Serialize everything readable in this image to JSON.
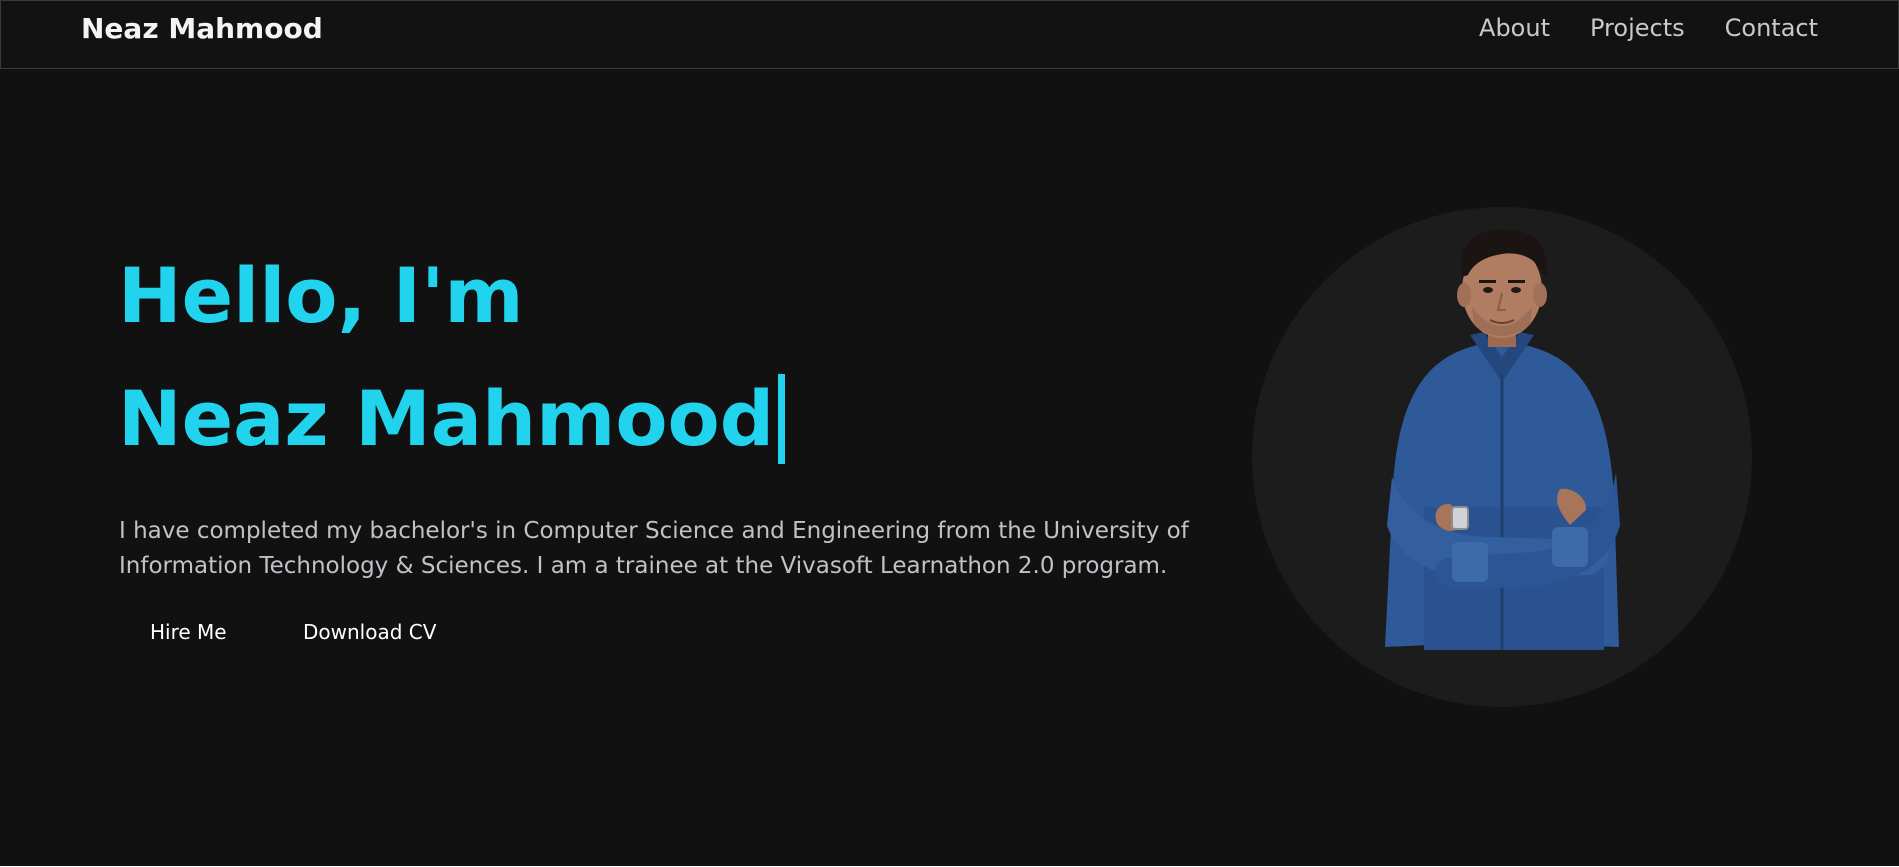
{
  "navbar": {
    "brand": "Neaz Mahmood",
    "links": [
      {
        "label": "About"
      },
      {
        "label": "Projects"
      },
      {
        "label": "Contact"
      }
    ]
  },
  "hero": {
    "greeting": "Hello, I'm",
    "name": "Neaz Mahmood",
    "description": "I have completed my bachelor's in Computer Science and Engineering from the University of Information Technology & Sciences. I am a trainee at the Vivasoft Learnathon 2.0 program.",
    "buttons": {
      "hire": "Hire Me",
      "cv": "Download CV"
    }
  },
  "colors": {
    "accent": "#22d3ee",
    "background": "#111111",
    "shirt": "#2f5a9a"
  }
}
